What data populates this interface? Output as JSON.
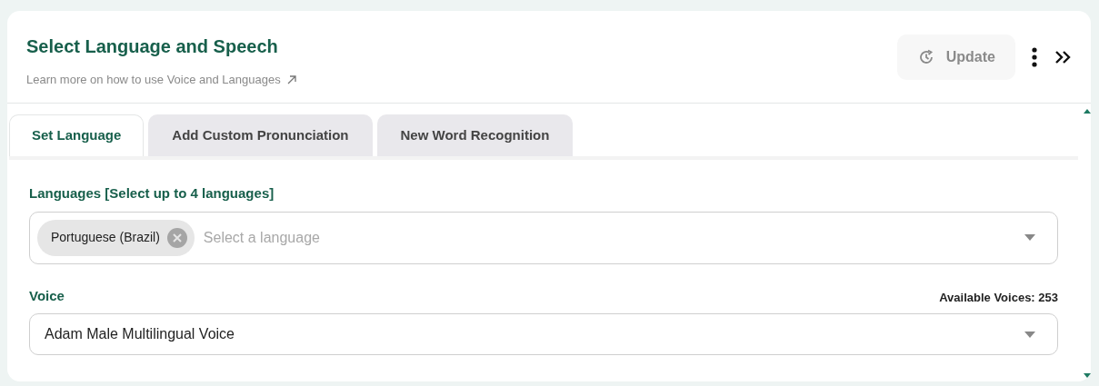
{
  "header": {
    "title": "Select Language and Speech",
    "help_link": "Learn more on how to use Voice and Languages",
    "update_button": {
      "label": "Update",
      "disabled": true
    }
  },
  "tabs": [
    {
      "label": "Set Language",
      "selected": true
    },
    {
      "label": "Add Custom Pronunciation",
      "selected": false
    },
    {
      "label": "New Word Recognition",
      "selected": false
    }
  ],
  "languages": {
    "label": "Languages [Select up to 4 languages]",
    "chips": [
      "Portuguese (Brazil)"
    ],
    "placeholder": "Select a language"
  },
  "voice": {
    "label": "Voice",
    "available": "Available Voices: 253",
    "value": "Adam Male Multilingual Voice"
  }
}
